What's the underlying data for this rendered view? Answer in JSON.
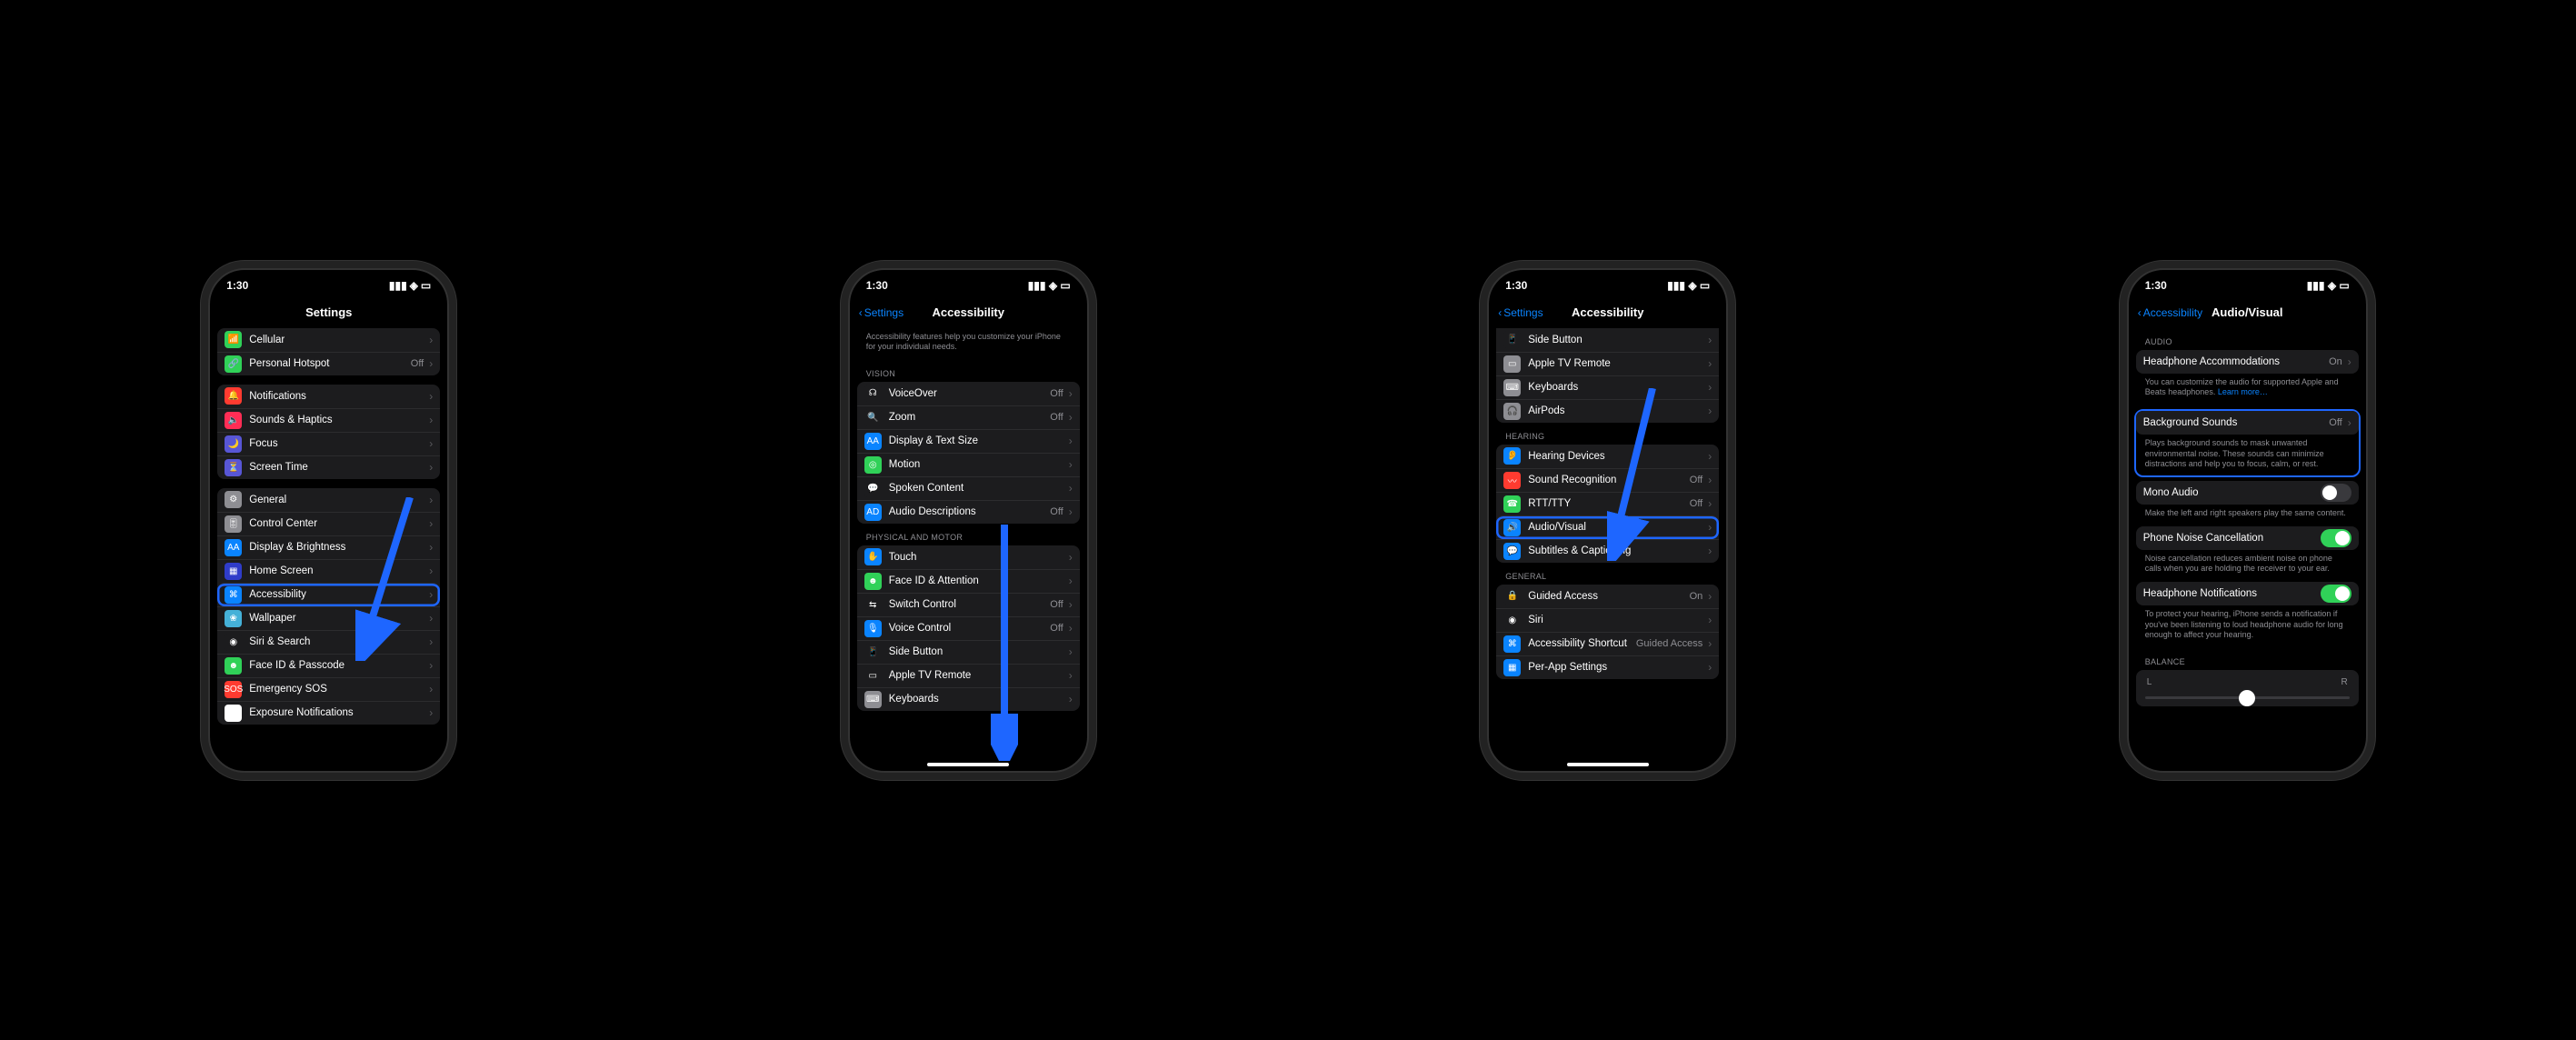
{
  "status": {
    "time": "1:30"
  },
  "screen1": {
    "title": "Settings",
    "rows_a": [
      {
        "label": "Cellular",
        "ic": "#30d158",
        "glyph": "📶"
      },
      {
        "label": "Personal Hotspot",
        "ic": "#30d158",
        "glyph": "🔗",
        "value": "Off"
      }
    ],
    "rows_b": [
      {
        "label": "Notifications",
        "ic": "#ff3b30",
        "glyph": "🔔"
      },
      {
        "label": "Sounds & Haptics",
        "ic": "#ff2d55",
        "glyph": "🔈"
      },
      {
        "label": "Focus",
        "ic": "#5856d6",
        "glyph": "🌙"
      },
      {
        "label": "Screen Time",
        "ic": "#5856d6",
        "glyph": "⏳"
      }
    ],
    "rows_c": [
      {
        "label": "General",
        "ic": "#8e8e93",
        "glyph": "⚙"
      },
      {
        "label": "Control Center",
        "ic": "#8e8e93",
        "glyph": "🎚"
      },
      {
        "label": "Display & Brightness",
        "ic": "#0a84ff",
        "glyph": "AA"
      },
      {
        "label": "Home Screen",
        "ic": "#2f3cc9",
        "glyph": "▦"
      },
      {
        "label": "Accessibility",
        "ic": "#0a84ff",
        "glyph": "⌘",
        "hl": true
      },
      {
        "label": "Wallpaper",
        "ic": "#45b1d8",
        "glyph": "❀"
      },
      {
        "label": "Siri & Search",
        "ic": "#1c1c1e",
        "glyph": "◉"
      },
      {
        "label": "Face ID & Passcode",
        "ic": "#30d158",
        "glyph": "☻"
      },
      {
        "label": "Emergency SOS",
        "ic": "#ff3b30",
        "glyph": "SOS"
      },
      {
        "label": "Exposure Notifications",
        "ic": "#fff",
        "glyph": "⊙"
      }
    ]
  },
  "screen2": {
    "back": "Settings",
    "title": "Accessibility",
    "intro": "Accessibility features help you customize your iPhone for your individual needs.",
    "visionLabel": "VISION",
    "vision": [
      {
        "label": "VoiceOver",
        "ic": "#1c1c1e",
        "glyph": "☊",
        "value": "Off"
      },
      {
        "label": "Zoom",
        "ic": "#1c1c1e",
        "glyph": "🔍",
        "value": "Off"
      },
      {
        "label": "Display & Text Size",
        "ic": "#0a84ff",
        "glyph": "AA"
      },
      {
        "label": "Motion",
        "ic": "#30d158",
        "glyph": "◎"
      },
      {
        "label": "Spoken Content",
        "ic": "#1c1c1e",
        "glyph": "💬"
      },
      {
        "label": "Audio Descriptions",
        "ic": "#0a84ff",
        "glyph": "AD",
        "value": "Off"
      }
    ],
    "pmLabel": "PHYSICAL AND MOTOR",
    "pm": [
      {
        "label": "Touch",
        "ic": "#0a84ff",
        "glyph": "✋"
      },
      {
        "label": "Face ID & Attention",
        "ic": "#30d158",
        "glyph": "☻"
      },
      {
        "label": "Switch Control",
        "ic": "#1c1c1e",
        "glyph": "⇆",
        "value": "Off"
      },
      {
        "label": "Voice Control",
        "ic": "#0a84ff",
        "glyph": "🎙",
        "value": "Off"
      },
      {
        "label": "Side Button",
        "ic": "#1c1c1e",
        "glyph": "📱"
      },
      {
        "label": "Apple TV Remote",
        "ic": "#1c1c1e",
        "glyph": "▭"
      },
      {
        "label": "Keyboards",
        "ic": "#8e8e93",
        "glyph": "⌨"
      }
    ]
  },
  "screen3": {
    "back": "Settings",
    "title": "Accessibility",
    "pmTail": [
      {
        "label": "Side Button",
        "ic": "#1c1c1e",
        "glyph": "📱"
      },
      {
        "label": "Apple TV Remote",
        "ic": "#8e8e93",
        "glyph": "▭"
      },
      {
        "label": "Keyboards",
        "ic": "#8e8e93",
        "glyph": "⌨"
      },
      {
        "label": "AirPods",
        "ic": "#8e8e93",
        "glyph": "🎧"
      }
    ],
    "hearingLabel": "HEARING",
    "hearing": [
      {
        "label": "Hearing Devices",
        "ic": "#0a84ff",
        "glyph": "👂"
      },
      {
        "label": "Sound Recognition",
        "ic": "#ff3b30",
        "glyph": "〰",
        "value": "Off"
      },
      {
        "label": "RTT/TTY",
        "ic": "#30d158",
        "glyph": "☎",
        "value": "Off"
      },
      {
        "label": "Audio/Visual",
        "ic": "#0a84ff",
        "glyph": "🔊",
        "hl": true
      },
      {
        "label": "Subtitles & Captioning",
        "ic": "#0a84ff",
        "glyph": "💬"
      }
    ],
    "generalLabel": "GENERAL",
    "general": [
      {
        "label": "Guided Access",
        "ic": "#1c1c1e",
        "glyph": "🔒",
        "value": "On"
      },
      {
        "label": "Siri",
        "ic": "#1c1c1e",
        "glyph": "◉"
      },
      {
        "label": "Accessibility Shortcut",
        "ic": "#0a84ff",
        "glyph": "⌘",
        "value": "Guided Access"
      },
      {
        "label": "Per-App Settings",
        "ic": "#0a84ff",
        "glyph": "▦"
      }
    ]
  },
  "screen4": {
    "back": "Accessibility",
    "title": "Audio/Visual",
    "audioLabel": "AUDIO",
    "hp": {
      "label": "Headphone Accommodations",
      "value": "On"
    },
    "hpBody": "You can customize the audio for supported Apple and Beats headphones.",
    "hpLink": "Learn more…",
    "bg": {
      "label": "Background Sounds",
      "value": "Off"
    },
    "bgBody": "Plays background sounds to mask unwanted environmental noise. These sounds can minimize distractions and help you to focus, calm, or rest.",
    "mono": {
      "label": "Mono Audio"
    },
    "monoBody": "Make the left and right speakers play the same content.",
    "noise": {
      "label": "Phone Noise Cancellation"
    },
    "noiseBody": "Noise cancellation reduces ambient noise on phone calls when you are holding the receiver to your ear.",
    "hpn": {
      "label": "Headphone Notifications"
    },
    "hpnBody": "To protect your hearing, iPhone sends a notification if you've been listening to loud headphone audio for long enough to affect your hearing.",
    "balanceLabel": "BALANCE",
    "balL": "L",
    "balR": "R"
  }
}
